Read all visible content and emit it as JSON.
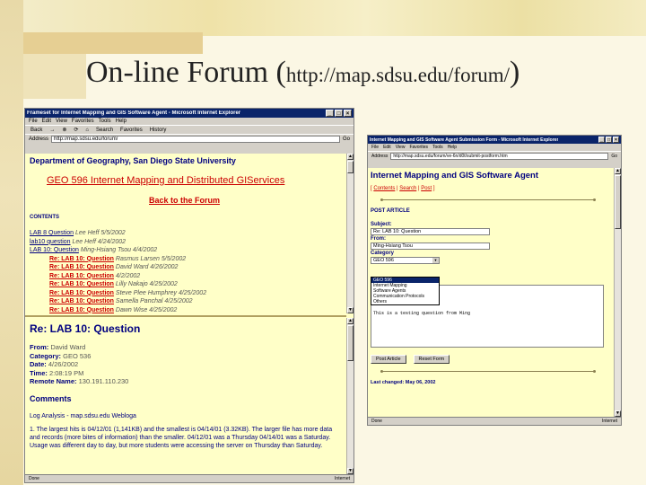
{
  "slide": {
    "title": "On-line Forum (",
    "url": "http://map.sdsu.edu/forum/",
    "close_paren": ")"
  },
  "left_window": {
    "titlebar": "Frameset for Internet Mapping and GIS Software Agent - Microsoft Internet Explorer",
    "menu": [
      "File",
      "Edit",
      "View",
      "Favorites",
      "Tools",
      "Help"
    ],
    "toolbar": [
      "Back",
      "→",
      "⊗",
      "⟳",
      "⌂",
      "Search",
      "Favorites",
      "History"
    ],
    "address_label": "Address",
    "address": "http://map.sdsu.edu/forum/",
    "go_label": "Go",
    "status_left": "Done",
    "status_right": "Internet",
    "content": {
      "department": "Department of Geography, San Diego State University",
      "course": "GEO 596 Internet Mapping and Distributed GIServices",
      "back_link": "Back to the Forum",
      "contents_label": "CONTENTS",
      "threads": [
        {
          "title": "LAB 8 Question",
          "by": "Lee Heff 5/5/2002",
          "indent": false,
          "active": false
        },
        {
          "title": "lab10 question",
          "by": "Lee Heff 4/24/2002",
          "indent": false,
          "active": false
        },
        {
          "title": "LAB 10: Question",
          "by": "Ming-Hsiang Tsou 4/4/2002",
          "indent": false,
          "active": false
        },
        {
          "title": "Re: LAB 10: Question",
          "by": "Rasmus Larsen 5/5/2002",
          "indent": true,
          "active": true
        },
        {
          "title": "Re: LAB 10: Question",
          "by": "David Ward 4/26/2002",
          "indent": true,
          "active": true
        },
        {
          "title": "Re: LAB 10: Question",
          "by": "4/2/2002",
          "indent": true,
          "active": true
        },
        {
          "title": "Re: LAB 10: Question",
          "by": "Lilly Nakajo 4/25/2002",
          "indent": true,
          "active": true
        },
        {
          "title": "Re: LAB 10: Question",
          "by": "Steve Plee Humphrey 4/25/2002",
          "indent": true,
          "active": true
        },
        {
          "title": "Re: LAB 10: Question",
          "by": "Samella Panchal 4/25/2002",
          "indent": true,
          "active": true
        },
        {
          "title": "Re: LAB 10: Question",
          "by": "Dawn Wise 4/25/2002",
          "indent": true,
          "active": true
        }
      ],
      "message_title": "Re: LAB 10: Question",
      "fields": [
        {
          "label": "From:",
          "value": "David Ward"
        },
        {
          "label": "Category:",
          "value": "GEO 536"
        },
        {
          "label": "Date:",
          "value": "4/26/2002"
        },
        {
          "label": "Time:",
          "value": "2:08:19 PM"
        },
        {
          "label": "Remote Name:",
          "value": "130.191.110.230"
        }
      ],
      "comments_label": "Comments",
      "body": [
        "Log Analysis - map.sdsu.edu Webloga",
        "1. The largest hits is 04/12/01 (1,141KB) and the smallest is 04/14/01 (3.32KB). The larger file has more data and records (more bites of information) than the smaller. 04/12/01 was a Thursday 04/14/01 was a Saturday. Usage was different day to day, but more students were accessing the server on Thursday than Saturday."
      ]
    }
  },
  "right_window": {
    "titlebar": "Internet Mapping and GIS Software Agent Submission Form - Microsoft Internet Explorer",
    "menu": [
      "File",
      "Edit",
      "View",
      "Favorites",
      "Tools",
      "Help"
    ],
    "address_label": "Address",
    "address": "http://map.sdsu.edu/forum/ve-6n/d0t/submit-postform.htm",
    "go_label": "Go",
    "status_left": "Done",
    "status_right": "Internet",
    "content": {
      "title": "Internet Mapping and GIS Software Agent",
      "links": [
        "Contents",
        "Search",
        "Post"
      ],
      "post_label": "POST ARTICLE",
      "subject_label": "Subject:",
      "subject_value": "Re: LAB 10: Question",
      "from_label": "From:",
      "from_value": "Ming-Hsiang Tsou",
      "category_label": "Category",
      "category_selected": "GEO 596",
      "category_options": [
        "GEO 596",
        "Internet Mapping",
        "Software Agents",
        "Communication Protocols",
        "Others"
      ],
      "message_text": "This is a testing question from Ming",
      "post_button": "Post Article",
      "reset_button": "Reset Form",
      "last_changed": "Last changed: May 06, 2002"
    }
  },
  "colors": {
    "page_bg": "#ffffc8",
    "link_red": "#cc0000",
    "heading_navy": "#000080",
    "titlebar_blue": "#0a246a"
  }
}
